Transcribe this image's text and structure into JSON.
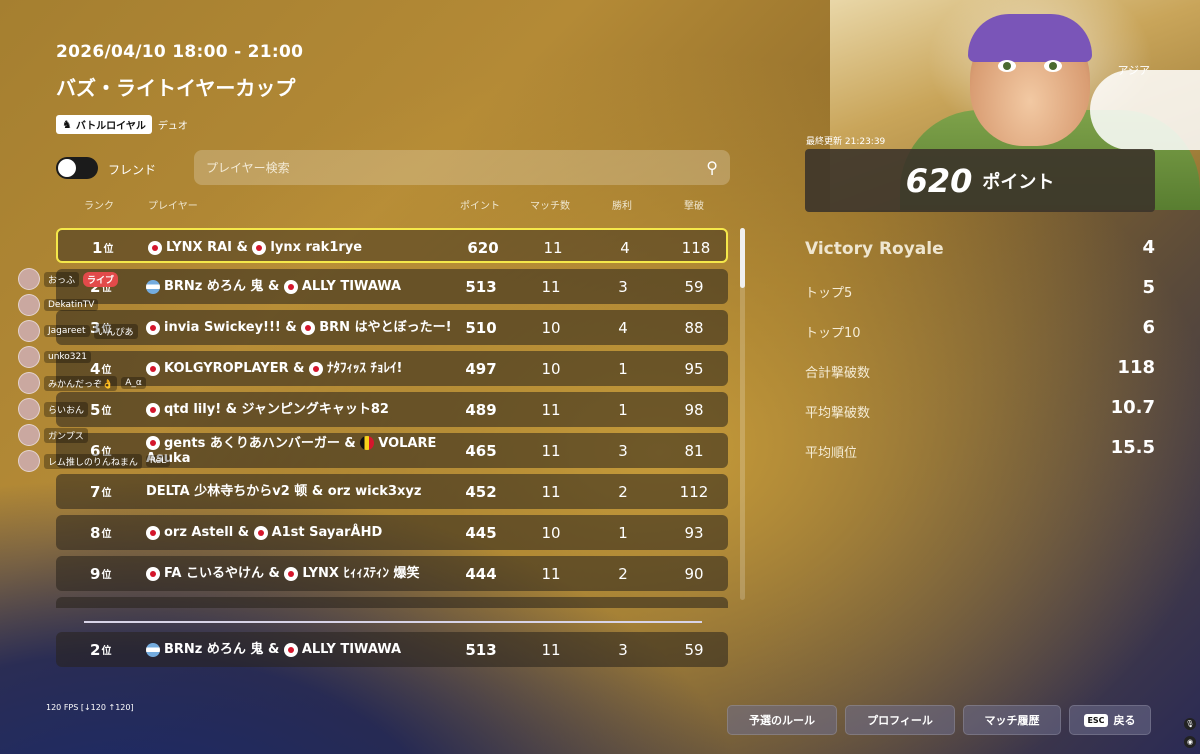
{
  "header": {
    "datetime": "2026/04/10 18:00 - 21:00",
    "title": "バズ・ライトイヤーカップ",
    "mode_badge": "バトルロイヤル",
    "mode_sub": "デュオ"
  },
  "region": "アジア",
  "controls": {
    "friend_label": "フレンド",
    "friend_toggle_on": false,
    "search_placeholder": "プレイヤー検索"
  },
  "columns": {
    "rank": "ランク",
    "player": "プレイヤー",
    "points": "ポイント",
    "matches": "マッチ数",
    "wins": "勝利",
    "kills": "撃破"
  },
  "rows": [
    {
      "rank": "1",
      "suffix": "位",
      "flag1": "jp",
      "p1": "LYNX RAI",
      "flag2": "jp",
      "p2": "lynx rak1rye",
      "points": "620",
      "matches": "11",
      "wins": "4",
      "kills": "118",
      "selected": true
    },
    {
      "rank": "2",
      "suffix": "位",
      "flag1": "ar",
      "p1": "BRNz めろん 鬼",
      "flag2": "jp",
      "p2": "ALLY TIWAWA",
      "points": "513",
      "matches": "11",
      "wins": "3",
      "kills": "59"
    },
    {
      "rank": "3",
      "suffix": "位",
      "flag1": "jp",
      "p1": "invia Swickey!!!",
      "flag2": "jp",
      "p2": "BRN はやとぼったー!",
      "points": "510",
      "matches": "10",
      "wins": "4",
      "kills": "88"
    },
    {
      "rank": "4",
      "suffix": "位",
      "flag1": "jp",
      "p1": "KOLGYROPLAYER",
      "flag2": "jp",
      "p2": "ﾅﾀﾌｨｯｽ ﾁｮﾚｲ!",
      "points": "497",
      "matches": "10",
      "wins": "1",
      "kills": "95"
    },
    {
      "rank": "5",
      "suffix": "位",
      "flag1": "jp",
      "p1": "qtd lily!",
      "flag2": "",
      "p2": "ジャンピングキャット82",
      "points": "489",
      "matches": "11",
      "wins": "1",
      "kills": "98"
    },
    {
      "rank": "6",
      "suffix": "位",
      "flag1": "jp",
      "p1": "gents あくりあハンバーガー",
      "flag2": "be",
      "p2": "VOLARE Asuka",
      "points": "465",
      "matches": "11",
      "wins": "3",
      "kills": "81"
    },
    {
      "rank": "7",
      "suffix": "位",
      "flag1": "",
      "p1": "DELTA 少林寺ちからv2 顿",
      "flag2": "",
      "p2": "orz wick3xyz",
      "points": "452",
      "matches": "11",
      "wins": "2",
      "kills": "112"
    },
    {
      "rank": "8",
      "suffix": "位",
      "flag1": "jp",
      "p1": "orz Astell",
      "flag2": "jp",
      "p2": "A1st SayarÅHD",
      "points": "445",
      "matches": "10",
      "wins": "1",
      "kills": "93"
    },
    {
      "rank": "9",
      "suffix": "位",
      "flag1": "jp",
      "p1": "FA こいるやけん",
      "flag2": "jp",
      "p2": "LYNX ﾋｨｨｽﾃｨﾝ 爆笑",
      "points": "444",
      "matches": "11",
      "wins": "2",
      "kills": "90"
    }
  ],
  "pinned": {
    "rank": "2",
    "suffix": "位",
    "flag1": "ar",
    "p1": "BRNz めろん 鬼",
    "flag2": "jp",
    "p2": "ALLY TIWAWA",
    "points": "513",
    "matches": "11",
    "wins": "3",
    "kills": "59"
  },
  "chat": [
    {
      "name": "おっふ",
      "badge": "ライブ"
    },
    {
      "name": "DekatinTV",
      "badge": ""
    },
    {
      "name": "Jagareet",
      "badge": "いんぴあ"
    },
    {
      "name": "unko321",
      "badge": ""
    },
    {
      "name": "みかんだっぞ👌",
      "badge": "A_α"
    },
    {
      "name": "らいおん",
      "badge": ""
    },
    {
      "name": "ガンプス",
      "badge": ""
    },
    {
      "name": "レム推しのりんねまん",
      "badge": "ReL"
    }
  ],
  "stats_panel": {
    "updated": "最終更新 21:23:39",
    "score": "620",
    "score_unit": "ポイント",
    "stats": [
      {
        "label": "Victory Royale",
        "value": "4"
      },
      {
        "label": "トップ5",
        "value": "5"
      },
      {
        "label": "トップ10",
        "value": "6"
      },
      {
        "label": "合計撃破数",
        "value": "118"
      },
      {
        "label": "平均撃破数",
        "value": "10.7"
      },
      {
        "label": "平均順位",
        "value": "15.5"
      }
    ]
  },
  "footer": {
    "fps": "120 FPS [↓120 ↑120]",
    "btn_rules": "予選のルール",
    "btn_profile": "プロフィール",
    "btn_history": "マッチ履歴",
    "esc": "ESC",
    "btn_back": "戻る"
  }
}
